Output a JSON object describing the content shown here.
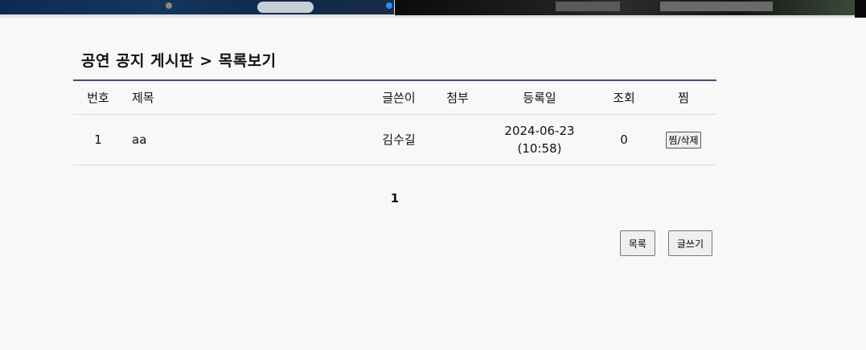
{
  "board": {
    "title": "공연 공지 게시판 > 목록보기",
    "columns": {
      "no": "번호",
      "title": "제목",
      "writer": "글쓴이",
      "attach": "첨부",
      "date": "등록일",
      "views": "조회",
      "fav": "찜"
    },
    "rows": [
      {
        "no": "1",
        "title": "aa",
        "writer": "김수길",
        "attach": "",
        "date": "2024-06-23",
        "time": "(10:58)",
        "views": "0",
        "fav_button": "찜/삭제"
      }
    ]
  },
  "pagination": {
    "current": "1"
  },
  "actions": {
    "list": "목록",
    "write": "글쓰기"
  }
}
